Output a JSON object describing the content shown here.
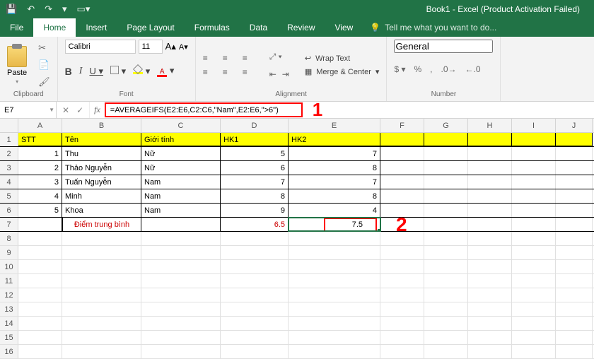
{
  "titlebar": {
    "title": "Book1 - Excel (Product Activation Failed)"
  },
  "tabs": {
    "file": "File",
    "home": "Home",
    "insert": "Insert",
    "pagelayout": "Page Layout",
    "formulas": "Formulas",
    "data": "Data",
    "review": "Review",
    "view": "View",
    "tell": "Tell me what you want to do..."
  },
  "ribbon": {
    "clipboard": {
      "paste": "Paste",
      "label": "Clipboard"
    },
    "font": {
      "name": "Calibri",
      "size": "11",
      "label": "Font"
    },
    "alignment": {
      "wrap": "Wrap Text",
      "merge": "Merge & Center",
      "label": "Alignment"
    },
    "number": {
      "format": "General",
      "label": "Number"
    }
  },
  "namebox": "E7",
  "formula": "=AVERAGEIFS(E2:E6,C2:C6,\"Nam\",E2:E6,\">6\")",
  "annotations": {
    "one": "1",
    "two": "2"
  },
  "columns": [
    "A",
    "B",
    "C",
    "D",
    "E",
    "F",
    "G",
    "H",
    "I",
    "J"
  ],
  "headers": {
    "stt": "STT",
    "ten": "Tên",
    "gioitinh": "Giới tính",
    "hk1": "HK1",
    "hk2": "HK2"
  },
  "rows": [
    {
      "n": "1",
      "stt": "1",
      "ten": "Thu",
      "gt": "Nữ",
      "hk1": "5",
      "hk2": "7"
    },
    {
      "n": "2",
      "stt": "2",
      "ten": "Thảo Nguyễn",
      "gt": "Nữ",
      "hk1": "6",
      "hk2": "8"
    },
    {
      "n": "3",
      "stt": "3",
      "ten": "Tuấn Nguyễn",
      "gt": "Nam",
      "hk1": "7",
      "hk2": "7"
    },
    {
      "n": "4",
      "stt": "4",
      "ten": "Minh",
      "gt": "Nam",
      "hk1": "8",
      "hk2": "8"
    },
    {
      "n": "5",
      "stt": "5",
      "ten": "Khoa",
      "gt": "Nam",
      "hk1": "9",
      "hk2": "4"
    }
  ],
  "avg": {
    "label": "Điểm trung bình",
    "hk1": "6.5",
    "hk2": "7.5"
  },
  "emptyrows": [
    "8",
    "9",
    "10",
    "11",
    "12",
    "13",
    "14",
    "15",
    "16"
  ]
}
